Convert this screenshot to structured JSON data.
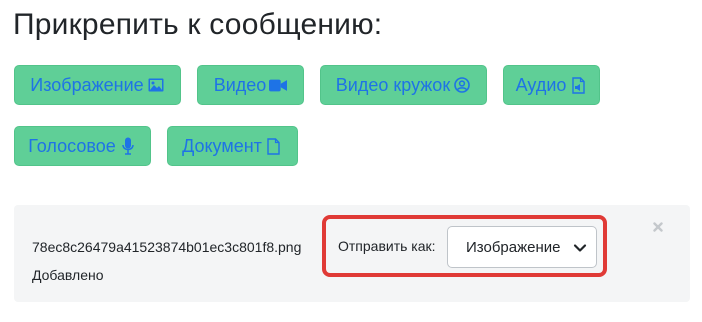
{
  "title": "Прикрепить к сообщению:",
  "attach_buttons": [
    {
      "label": "Изображение",
      "icon": "image-icon"
    },
    {
      "label": "Видео",
      "icon": "video-camera-icon"
    },
    {
      "label": "Видео кружок",
      "icon": "user-circle-icon"
    },
    {
      "label": "Аудио",
      "icon": "audio-file-icon"
    },
    {
      "label": "Голосовое",
      "icon": "microphone-icon"
    },
    {
      "label": "Документ",
      "icon": "document-icon"
    }
  ],
  "attachment": {
    "file_name": "78ec8c26479a41523874b01ec3c801f8.png",
    "status": "Добавлено",
    "send_as_label": "Отправить как:",
    "send_as_value": "Изображение",
    "remove_icon": "close-icon"
  },
  "colors": {
    "button_bg": "#5fcf97",
    "button_text": "#1e73e6",
    "highlight_border": "#e03a36",
    "panel_bg": "#f4f5f6"
  }
}
